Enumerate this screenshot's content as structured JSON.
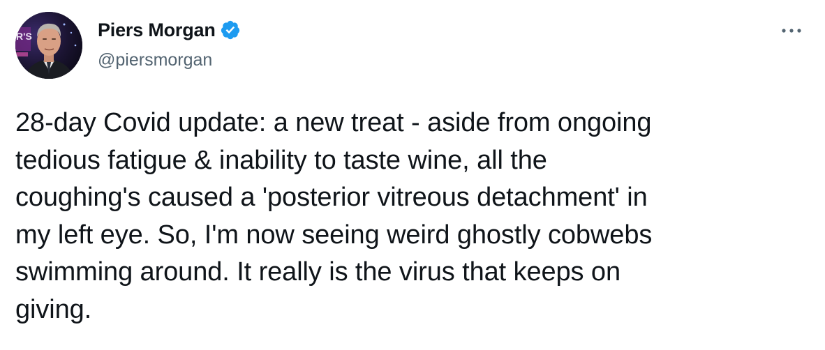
{
  "author": {
    "display_name": "Piers Morgan",
    "handle": "@piersmorgan",
    "verified": true,
    "avatar_icon": "user-avatar-photo",
    "avatar_background_text": "R'S"
  },
  "menu": {
    "more_icon": "more-horizontal-icon"
  },
  "tweet": {
    "lines": [
      "28-day Covid update: a new treat - aside from ongoing",
      "tedious fatigue & inability to taste wine, all the",
      "coughing's caused a 'posterior vitreous detachment' in",
      "my left eye. So, I'm now seeing weird ghostly cobwebs",
      "swimming around. It really is the virus that keeps on",
      "giving."
    ]
  },
  "colors": {
    "text_primary": "#0f1419",
    "text_secondary": "#536471",
    "verified_blue": "#1d9bf0",
    "background": "#ffffff"
  }
}
